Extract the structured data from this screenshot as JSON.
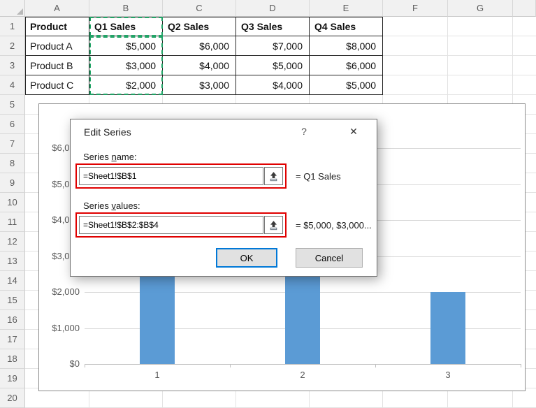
{
  "colors": {
    "bar_color": "#5b9bd5",
    "selection_green": "#21a366",
    "annotation_red": "#e00000",
    "default_button_border": "#0078d7"
  },
  "spreadsheet": {
    "column_headers": [
      "A",
      "B",
      "C",
      "D",
      "E",
      "F",
      "G"
    ],
    "row_count": 20,
    "table": {
      "headers": [
        "Product",
        "Q1 Sales",
        "Q2 Sales",
        "Q3 Sales",
        "Q4 Sales"
      ],
      "rows": [
        [
          "Product A",
          "$5,000",
          "$6,000",
          "$7,000",
          "$8,000"
        ],
        [
          "Product B",
          "$3,000",
          "$4,000",
          "$5,000",
          "$6,000"
        ],
        [
          "Product C",
          "$2,000",
          "$3,000",
          "$4,000",
          "$5,000"
        ]
      ]
    }
  },
  "chart_data": {
    "type": "bar",
    "categories": [
      "1",
      "2",
      "3"
    ],
    "series": [
      {
        "name": "Q1 Sales",
        "values": [
          5000,
          3000,
          2000
        ]
      }
    ],
    "title": "",
    "xlabel": "",
    "ylabel": "",
    "ylim": [
      0,
      6000
    ],
    "ytick_step": 1000,
    "ytick_labels": [
      "$0",
      "$1,000",
      "$2,000",
      "$3,000",
      "$4,000",
      "$5,000",
      "$6,000"
    ],
    "grid": true,
    "legend": "none"
  },
  "dialog": {
    "title": "Edit Series",
    "help_label": "?",
    "close_label": "✕",
    "series_name_label": {
      "pre": "Series ",
      "key": "n",
      "post": "ame:"
    },
    "series_name_value": "=Sheet1!$B$1",
    "series_name_result": "= Q1 Sales",
    "series_values_label": {
      "pre": "Series ",
      "key": "v",
      "post": "alues:"
    },
    "series_values_value": "=Sheet1!$B$2:$B$4",
    "series_values_result": "= $5,000, $3,000...",
    "ok_label": "OK",
    "cancel_label": "Cancel"
  }
}
